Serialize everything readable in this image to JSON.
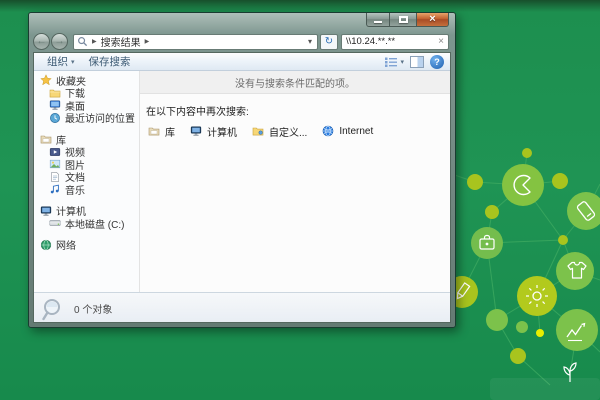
{
  "colors": {
    "desktop_green": "#1f9454",
    "desktop_green_deep": "#178a4c",
    "window_frame": "#7d968f",
    "close_button_orange": "#c2602f",
    "decoration_olive": "#a8c41e",
    "decoration_lime": "#7cc24b",
    "decoration_yellow": "#e9ee00",
    "toolbar_text": "#3c5a74"
  },
  "icons": {
    "back": "←",
    "forward": "→",
    "breadcrumb_arrow": "▶",
    "address_dropdown": "▾",
    "refresh": "↻",
    "clear_search": "×",
    "close": "×",
    "organize_dropdown": "▾",
    "views_dropdown": "▾",
    "help": "?"
  },
  "window": {
    "address": {
      "breadcrumb": "搜索结果"
    },
    "search": {
      "value": "\\\\10.24.**.**"
    },
    "toolbar": {
      "organize_label": "组织",
      "save_search_label": "保存搜索"
    },
    "sidebar": {
      "items": [
        {
          "key": "favorites",
          "label": "收藏夹",
          "icon": "star",
          "indent": 0,
          "gap": false
        },
        {
          "key": "downloads",
          "label": "下载",
          "icon": "folder",
          "indent": 1,
          "gap": false
        },
        {
          "key": "desktop",
          "label": "桌面",
          "icon": "desktop",
          "indent": 1,
          "gap": false
        },
        {
          "key": "recent-places",
          "label": "最近访问的位置",
          "icon": "recent",
          "indent": 1,
          "gap": false
        },
        {
          "key": "libraries",
          "label": "库",
          "icon": "library",
          "indent": 0,
          "gap": true
        },
        {
          "key": "videos",
          "label": "视频",
          "icon": "video",
          "indent": 1,
          "gap": false
        },
        {
          "key": "pictures",
          "label": "图片",
          "icon": "picture",
          "indent": 1,
          "gap": false
        },
        {
          "key": "documents",
          "label": "文档",
          "icon": "document",
          "indent": 1,
          "gap": false
        },
        {
          "key": "music",
          "label": "音乐",
          "icon": "music",
          "indent": 1,
          "gap": false
        },
        {
          "key": "computer",
          "label": "计算机",
          "icon": "computer",
          "indent": 0,
          "gap": true
        },
        {
          "key": "local-disk-c",
          "label": "本地磁盘 (C:)",
          "icon": "disk",
          "indent": 1,
          "gap": false
        },
        {
          "key": "network",
          "label": "网络",
          "icon": "network",
          "indent": 0,
          "gap": true
        }
      ]
    },
    "content": {
      "empty_message": "没有与搜索条件匹配的项。",
      "search_again_label": "在以下内容中再次搜索:",
      "targets": [
        {
          "key": "libraries",
          "label": "库",
          "icon": "library"
        },
        {
          "key": "computer",
          "label": "计算机",
          "icon": "computer"
        },
        {
          "key": "custom",
          "label": "自定义...",
          "icon": "custom"
        },
        {
          "key": "internet",
          "label": "Internet",
          "icon": "internet"
        }
      ]
    },
    "statusbar": {
      "items_count": "0 个对象"
    }
  }
}
